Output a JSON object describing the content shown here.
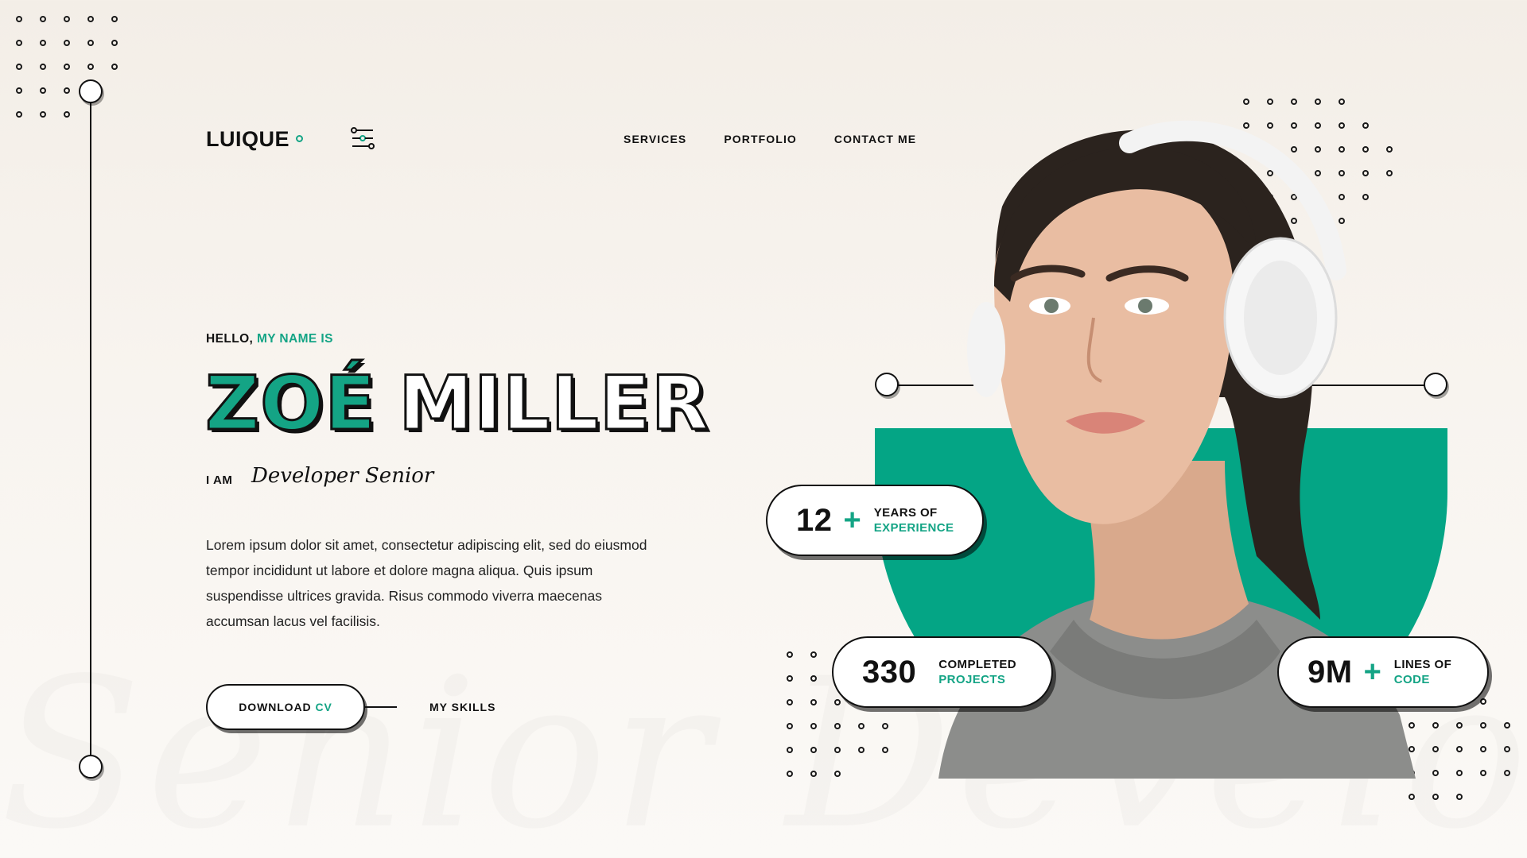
{
  "header": {
    "logo": "LUIQUE",
    "nav": [
      "SERVICES",
      "PORTFOLIO",
      "CONTACT ME"
    ]
  },
  "hero": {
    "greeting": "HELLO,",
    "greeting_accent": "MY NAME IS",
    "first_name": "ZOÉ",
    "last_name": "MILLER",
    "i_am": "I AM",
    "role": "Developer Senior",
    "description": "Lorem ipsum dolor sit amet, consectetur adipiscing elit, sed do eiusmod tempor incididunt ut labore et dolore magna aliqua. Quis ipsum suspendisse ultrices gravida. Risus commodo viverra maecenas accumsan lacus vel facilisis.",
    "download_label": "DOWNLOAD",
    "download_accent": "CV",
    "skills_label": "MY SKILLS",
    "watermark": "Senior Developer"
  },
  "stats": [
    {
      "number": "12",
      "plus": "+",
      "line1": "YEARS OF",
      "line2": "EXPERIENCE"
    },
    {
      "number": "330",
      "plus": "",
      "line1": "COMPLETED",
      "line2": "PROJECTS"
    },
    {
      "number": "9M",
      "plus": "+",
      "line1": "LINES OF",
      "line2": "CODE"
    }
  ],
  "colors": {
    "accent": "#14a485",
    "shape": "#04a585",
    "ink": "#111111"
  }
}
